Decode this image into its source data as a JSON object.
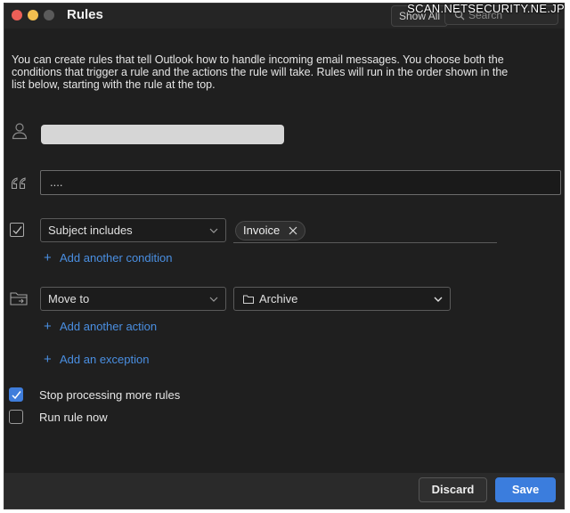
{
  "window": {
    "title": "Rules",
    "show_all_label": "Show All",
    "search_placeholder": "Search"
  },
  "watermark": "SCAN.NETSECURITY.NE.JP",
  "intro_text": "You can create rules that tell Outlook how to handle incoming email messages. You choose both the conditions that trigger a rule and the actions the rule will take. Rules will run in the order shown in the list below, starting with the rule at the top.",
  "rule": {
    "name_value": "",
    "text_value": "....",
    "condition": {
      "type_label": "Subject includes",
      "tag_value": "Invoice"
    },
    "add_condition_label": "Add another condition",
    "action": {
      "type_label": "Move to",
      "folder_label": "Archive"
    },
    "add_action_label": "Add another action",
    "add_exception_label": "Add an exception"
  },
  "options": {
    "stop_processing_label": "Stop processing more rules",
    "stop_processing_checked": true,
    "run_now_label": "Run rule now",
    "run_now_checked": false
  },
  "footer": {
    "discard_label": "Discard",
    "save_label": "Save"
  },
  "icons": [
    "person-icon",
    "quote-icon",
    "checkbox-icon",
    "folder-move-icon",
    "folder-icon",
    "chevron-down-icon",
    "close-icon",
    "plus-icon",
    "search-icon"
  ],
  "colors": {
    "accent": "#3b7ddd",
    "link": "#4a8fe2",
    "background": "#1f1f1f"
  }
}
